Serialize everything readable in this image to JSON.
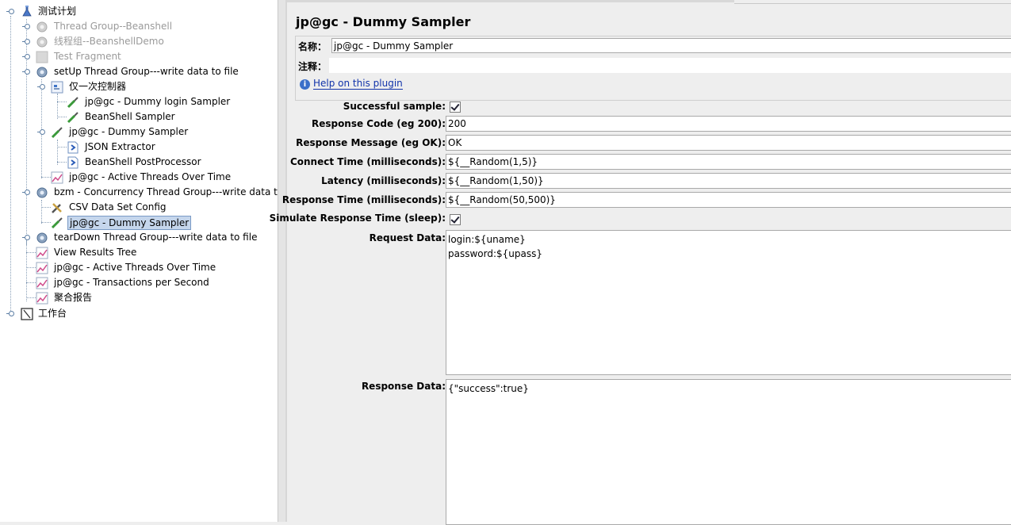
{
  "tree": {
    "root": "测试计划",
    "items": [
      {
        "label": "Thread Group--Beanshell",
        "disabled": true
      },
      {
        "label": "线程组--BeanshellDemo",
        "disabled": true
      },
      {
        "label": "Test Fragment",
        "disabled": true
      },
      {
        "label": "setUp Thread Group---write data to file"
      },
      {
        "label": "仅一次控制器"
      },
      {
        "label": "jp@gc - Dummy login Sampler"
      },
      {
        "label": "BeanShell Sampler"
      },
      {
        "label": "jp@gc - Dummy Sampler"
      },
      {
        "label": "JSON Extractor"
      },
      {
        "label": "BeanShell PostProcessor"
      },
      {
        "label": "jp@gc - Active Threads Over Time"
      },
      {
        "label": "bzm - Concurrency Thread Group---write data to file"
      },
      {
        "label": "CSV Data Set Config"
      },
      {
        "label": "jp@gc - Dummy Sampler",
        "selected": true
      },
      {
        "label": "tearDown Thread Group---write data to file"
      },
      {
        "label": "View Results Tree"
      },
      {
        "label": "jp@gc - Active Threads Over Time"
      },
      {
        "label": "jp@gc - Transactions per Second"
      },
      {
        "label": "聚合报告"
      }
    ],
    "workbench": "工作台"
  },
  "panel": {
    "title": "jp@gc - Dummy Sampler",
    "name_label": "名称：",
    "name_value": "jp@gc - Dummy Sampler",
    "comment_label": "注释：",
    "comment_value": "",
    "help_link": "Help on this plugin"
  },
  "form": {
    "successful_label": "Successful sample:",
    "successful_checked": true,
    "response_code_label": "Response Code (eg 200):",
    "response_code": "200",
    "response_message_label": "Response Message (eg OK):",
    "response_message": "OK",
    "connect_time_label": "Connect Time (milliseconds):",
    "connect_time": "${__Random(1,5)}",
    "latency_label": "Latency (milliseconds):",
    "latency": "${__Random(1,50)}",
    "response_time_label": "Response Time (milliseconds):",
    "response_time": "${__Random(50,500)}",
    "simulate_label": "Simulate Response Time (sleep):",
    "simulate_checked": true,
    "request_data_label": "Request Data:",
    "request_data": "login:${uname}\npassword:${upass}",
    "response_data_label": "Response Data:",
    "response_data": "{\"success\":true}"
  }
}
